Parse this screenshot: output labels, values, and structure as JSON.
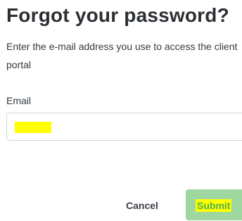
{
  "form": {
    "title": "Forgot your password?",
    "description": "Enter the e-mail address you use to access the client portal",
    "email_label": "Email",
    "email_value": ""
  },
  "actions": {
    "cancel_label": "Cancel",
    "submit_label": "Submit"
  },
  "colors": {
    "submit_background": "#9fd7a1",
    "highlight": "#ffff00",
    "submit_text": "#4caf50"
  }
}
